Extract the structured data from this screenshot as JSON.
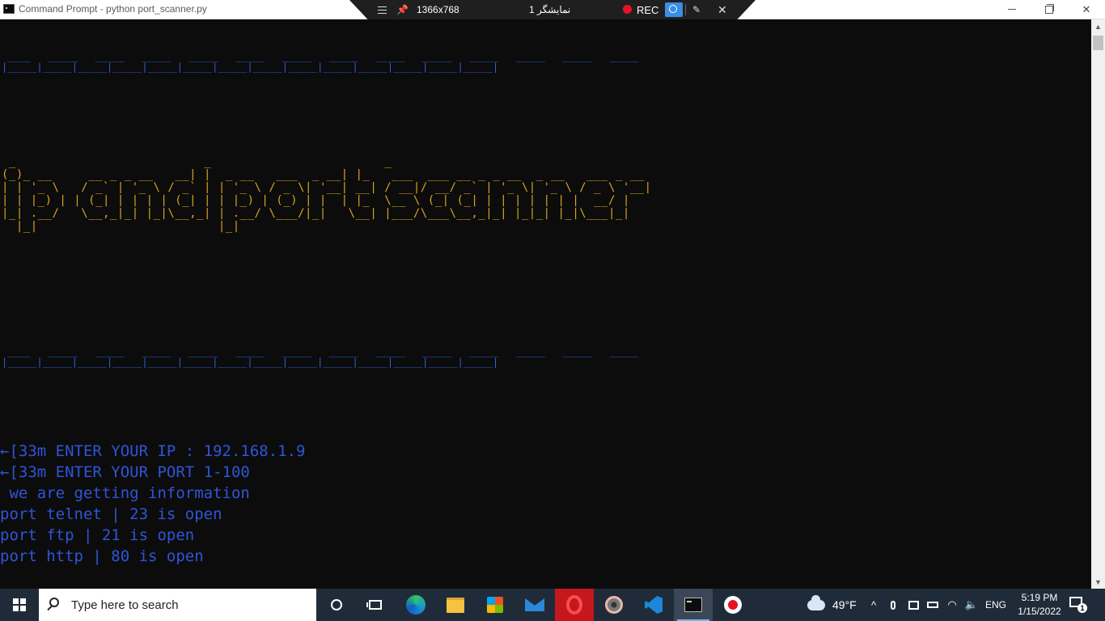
{
  "window": {
    "title": "Command Prompt - python  port_scanner.py",
    "minimize_glyph": "—",
    "close_glyph": "✕"
  },
  "recorder_toolbar": {
    "resolution": "1366x768",
    "display": "نمایشگر 1",
    "rec_label": "REC",
    "close_glyph": "✕",
    "pen_glyph": "✎",
    "pin_glyph": "📌"
  },
  "console": {
    "rule_lines": [
      " ____   _____   _____   _____   _____   _____   _____   _____   _____   _____   _____   _____   _____   _____ ",
      "|_____|_____|_____|_____|_____|_____|_____|_____|_____|_____|_____|_____|_____|_____|"
    ],
    "banner": [
      " _                          _                        _                                                 ",
      "(_)_ __     __ _ _ __   __| |  _ __   ___  _ __| |_   ___  ___ __ _ _ __  _ __   ___ _ __ ",
      "| | '_ \\   / _` | '_ \\ / _` | | '_ \\ / _ \\| '__| __| / __|/ __/ _` | '_ \\| '_ \\ / _ \\ '__|",
      "| | |_) | | (_| | | | | (_| | | |_) | (_) | |  | |_  \\__ \\ (_| (_| | | | | | | |  __/ |   ",
      "|_| .__/   \\__,_|_| |_|\\__,_| | .__/ \\___/|_|   \\__| |___/\\___\\__,_|_| |_|_| |_|\\___|_|   ",
      "  |_|                         |_|                                                         "
    ],
    "output_lines": [
      "←[33m ENTER YOUR IP : 192.168.1.9",
      "←[33m ENTER YOUR PORT 1-100",
      " we are getting information",
      "port telnet | 23 is open",
      "port ftp | 21 is open",
      "port http | 80 is open"
    ]
  },
  "scrollbar": {
    "up_glyph": "▲",
    "down_glyph": "▼"
  },
  "taskbar": {
    "search_placeholder": "Type here to search",
    "weather_temp": "49°F",
    "tray_chevron": "^",
    "wifi_glyph": "◠",
    "volume_glyph": "🔈",
    "language": "ENG",
    "time": "5:19 PM",
    "date": "1/15/2022",
    "notification_count": "1"
  }
}
